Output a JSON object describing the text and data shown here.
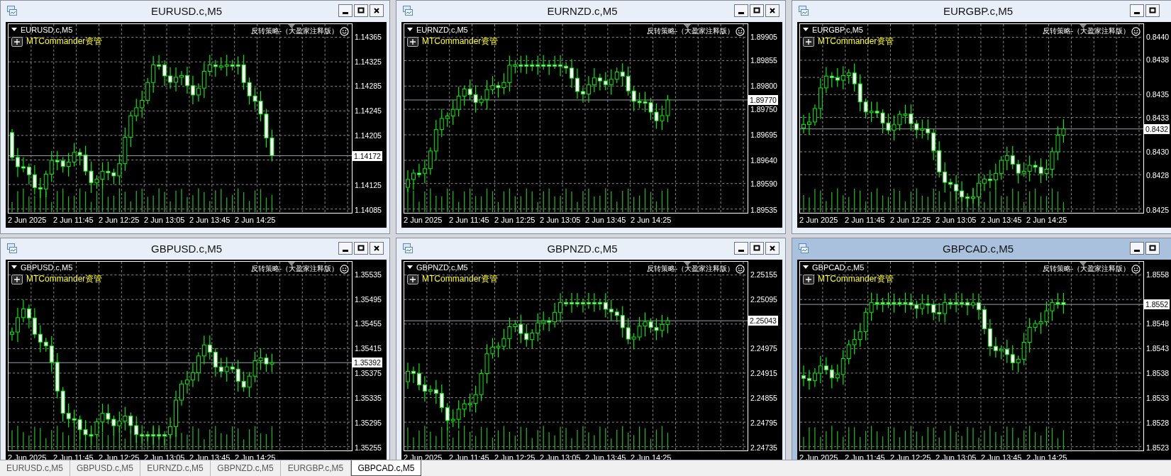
{
  "windows": [
    {
      "title": "EURUSD.c,M5",
      "active": false,
      "controls": [
        {
          "kind": "minimize"
        },
        {
          "kind": "maximize"
        },
        {
          "kind": "close"
        }
      ],
      "chart": {
        "symbol_label": "EURUSD.c,M5",
        "indicator": "MTCommander资管",
        "expert": "反转策略-（大盈家注释版）",
        "price_axis": [
          "1.14365",
          "1.14325",
          "1.14285",
          "1.14245",
          "1.14205",
          "1.14125",
          "1.14085"
        ],
        "current_price": "1.14172",
        "time_axis": [
          "2 Jun 2025",
          "2 Jun 11:45",
          "2 Jun 12:25",
          "2 Jun 13:05",
          "2 Jun 13:45",
          "2 Jun 14:25"
        ]
      }
    },
    {
      "title": "EURNZD.c,M5",
      "active": false,
      "controls": [
        {
          "kind": "minimize"
        },
        {
          "kind": "maximize"
        },
        {
          "kind": "close"
        }
      ],
      "chart": {
        "symbol_label": "EURNZD.c,M5",
        "indicator": "MTCommander资管",
        "expert": "反转策略-（大盈家注释版）",
        "price_axis": [
          "1.89905",
          "1.89855",
          "1.89800",
          "1.89750",
          "1.89695",
          "1.89640",
          "1.89590",
          "1.89535"
        ],
        "current_price": "1.89770",
        "time_axis": [
          "2 Jun 2025",
          "2 Jun 11:45",
          "2 Jun 12:25",
          "2 Jun 13:05",
          "2 Jun 13:45",
          "2 Jun 14:25"
        ]
      }
    },
    {
      "title": "EURGBP.c,M5",
      "active": false,
      "controls": [
        {
          "kind": "minimize"
        },
        {
          "kind": "maximize"
        }
      ],
      "chart": {
        "symbol_label": "EURGBP.c,M5",
        "indicator": "MTCommander资管",
        "expert": "反转策略-（大盈家注释版）",
        "price_axis": [
          "0.8440",
          "0.8438",
          "0.8435",
          "0.8433",
          "0.8430",
          "0.8428",
          "0.8425"
        ],
        "current_price": "0.8432",
        "time_axis": [
          "2 Jun 2025",
          "2 Jun 11:45",
          "2 Jun 12:25",
          "2 Jun 13:05",
          "2 Jun 13:45",
          "2 Jun 14:25"
        ]
      }
    },
    {
      "title": "GBPUSD.c,M5",
      "active": false,
      "controls": [
        {
          "kind": "minimize"
        },
        {
          "kind": "maximize"
        },
        {
          "kind": "close"
        }
      ],
      "chart": {
        "symbol_label": "GBPUSD.c,M5",
        "indicator": "MTCommander资管",
        "expert": "反转策略-（大盈家注释版）",
        "price_axis": [
          "1.35535",
          "1.35495",
          "1.35455",
          "1.35415",
          "1.35375",
          "1.35335",
          "1.35295",
          "1.35255"
        ],
        "current_price": "1.35392",
        "time_axis": [
          "2 Jun 2025",
          "2 Jun 11:45",
          "2 Jun 12:25",
          "2 Jun 13:05",
          "2 Jun 13:45",
          "2 Jun 14:25"
        ]
      }
    },
    {
      "title": "GBPNZD.c,M5",
      "active": false,
      "controls": [
        {
          "kind": "minimize"
        },
        {
          "kind": "maximize"
        },
        {
          "kind": "close"
        }
      ],
      "chart": {
        "symbol_label": "GBPNZD.c,M5",
        "indicator": "MTCommander资管",
        "expert": "反转策略-（大盈家注释版）",
        "price_axis": [
          "2.25155",
          "2.25095",
          "2.24975",
          "2.24915",
          "2.24855",
          "2.24795",
          "2.24735"
        ],
        "current_price": "2.25043",
        "time_axis": [
          "2 Jun 2025",
          "2 Jun 11:45",
          "2 Jun 12:25",
          "2 Jun 13:05",
          "2 Jun 13:45",
          "2 Jun 14:25"
        ]
      }
    },
    {
      "title": "GBPCAD.c,M5",
      "active": true,
      "controls": [
        {
          "kind": "minimize"
        },
        {
          "kind": "maximize"
        }
      ],
      "chart": {
        "symbol_label": "GBPCAD.c,M5",
        "indicator": "MTCommander资管",
        "expert": "反转策略-（大盈家注释版）",
        "price_axis": [
          "1.8558",
          "1.8548",
          "1.8543",
          "1.8538",
          "1.8533",
          "1.8528",
          "1.8523"
        ],
        "current_price": "1.8552",
        "time_axis": [
          "2 Jun 2025",
          "2 Jun 11:45",
          "2 Jun 12:25",
          "2 Jun 13:05",
          "2 Jun 13:45",
          "2 Jun 14:25"
        ]
      }
    }
  ],
  "tabs": [
    {
      "label": "EURUSD.c,M5",
      "selected": false
    },
    {
      "label": "GBPUSD.c,M5",
      "selected": false
    },
    {
      "label": "EURNZD.c,M5",
      "selected": false
    },
    {
      "label": "GBPNZD.c,M5",
      "selected": false
    },
    {
      "label": "EURGBP.c,M5",
      "selected": false
    },
    {
      "label": "GBPCAD.c,M5",
      "selected": true
    }
  ]
}
